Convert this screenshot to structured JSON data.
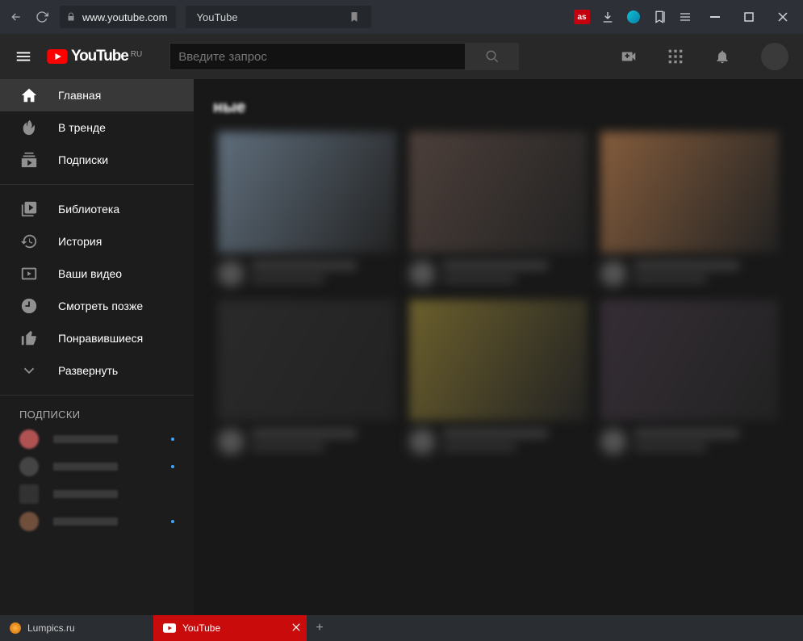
{
  "browser": {
    "url": "www.youtube.com",
    "tab_title": "YouTube"
  },
  "header": {
    "logo": "YouTube",
    "region": "RU",
    "search_placeholder": "Введите запрос"
  },
  "sidebar": {
    "items": [
      {
        "label": "Главная",
        "icon": "home-icon",
        "active": true
      },
      {
        "label": "В тренде",
        "icon": "trending-icon",
        "active": false
      },
      {
        "label": "Подписки",
        "icon": "subscriptions-icon",
        "active": false
      }
    ],
    "items2": [
      {
        "label": "Библиотека",
        "icon": "library-icon"
      },
      {
        "label": "История",
        "icon": "history-icon"
      },
      {
        "label": "Ваши видео",
        "icon": "your-videos-icon"
      },
      {
        "label": "Смотреть позже",
        "icon": "watch-later-icon"
      },
      {
        "label": "Понравившиеся",
        "icon": "liked-icon"
      },
      {
        "label": "Развернуть",
        "icon": "expand-icon"
      }
    ],
    "subs_heading": "ПОДПИСКИ"
  },
  "content": {
    "section_title_fragment": "ные",
    "thumbs": [
      "#5f6e7c",
      "#4c3f3a",
      "#845c3c",
      "#2a2a2a",
      "#6b5f2c",
      "#352e35"
    ]
  },
  "taskbar": {
    "tab1": "Lumpics.ru",
    "tab2": "YouTube"
  }
}
